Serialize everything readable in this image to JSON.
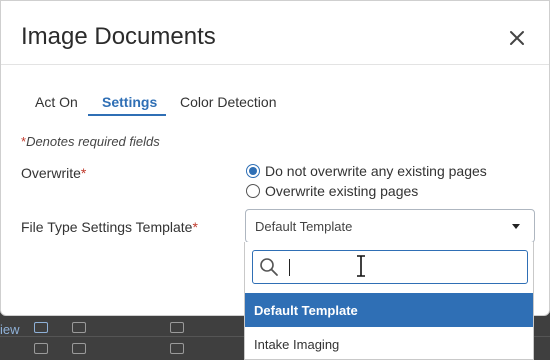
{
  "dialog": {
    "title": "Image Documents",
    "close_icon": "close-icon"
  },
  "tabs": [
    {
      "label": "Act On",
      "active": false
    },
    {
      "label": "Settings",
      "active": true
    },
    {
      "label": "Color Detection",
      "active": false
    }
  ],
  "form": {
    "required_note_star": "*",
    "required_note": "Denotes required fields",
    "overwrite": {
      "label": "Overwrite",
      "star": "*",
      "options": [
        {
          "label": "Do not overwrite any existing pages",
          "checked": true
        },
        {
          "label": "Overwrite existing pages",
          "checked": false
        }
      ]
    },
    "template": {
      "label": "File Type Settings Template",
      "star": "*",
      "selected_value": "Default Template",
      "search_value": "",
      "options": [
        {
          "label": "Default Template",
          "highlighted": true
        },
        {
          "label": "Intake Imaging",
          "highlighted": false
        }
      ]
    }
  },
  "background": {
    "link_text": "iew"
  },
  "colors": {
    "accent": "#2f6fb5",
    "required": "#c0392b",
    "overlay": "#4a4a4a"
  }
}
